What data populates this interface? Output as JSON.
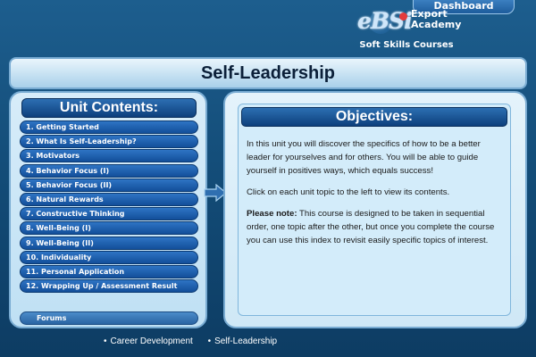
{
  "header": {
    "dashboard_label": "Dashboard",
    "logo": {
      "brand": "eBSi",
      "line1": "Export",
      "line2": "Academy"
    },
    "subtitle": "Soft Skills Courses"
  },
  "page_title": "Self-Leadership",
  "unit_contents": {
    "title": "Unit Contents:",
    "items": [
      {
        "label": "1. Getting Started"
      },
      {
        "label": "2. What Is Self-Leadership?"
      },
      {
        "label": "3. Motivators"
      },
      {
        "label": "4. Behavior Focus (I)"
      },
      {
        "label": "5. Behavior Focus (II)"
      },
      {
        "label": "6. Natural Rewards"
      },
      {
        "label": "7. Constructive Thinking"
      },
      {
        "label": "8. Well-Being (I)"
      },
      {
        "label": "9. Well-Being (II)"
      },
      {
        "label": "10. Individuality"
      },
      {
        "label": "11. Personal Application"
      },
      {
        "label": "12. Wrapping Up / Assessment Result"
      }
    ],
    "forums_label": "Forums"
  },
  "objectives": {
    "title": "Objectives:",
    "paragraph1": "In this unit you will discover the specifics of how to be a better leader for yourselves and for others. You will be able to guide yourself in positives ways, which equals success!",
    "paragraph2": "Click on each unit topic to the left to view its contents.",
    "note_label": "Please note:",
    "note_text": " This course is designed to be taken in sequential order, one topic after the other, but once you complete the course you can use this index to revisit easily specific topics of interest."
  },
  "breadcrumb": {
    "items": [
      "Career Development",
      "Self-Leadership"
    ]
  },
  "colors": {
    "background": "#124a75",
    "button_blue": "#134f9a",
    "panel_light": "#d7ecf9"
  }
}
